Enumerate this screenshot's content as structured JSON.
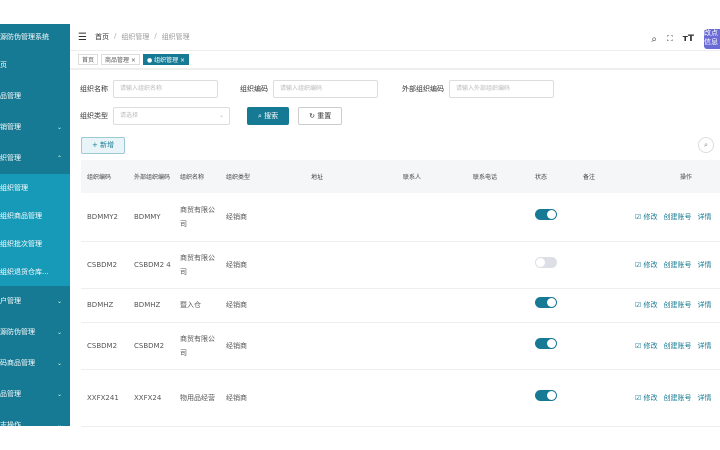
{
  "sidebar": {
    "title": "源防伪管理系统",
    "items": [
      {
        "label": "页"
      },
      {
        "label": "品管理"
      },
      {
        "label": "销管理",
        "chev": "⌄"
      },
      {
        "label": "织管理",
        "chev": "⌃"
      }
    ],
    "sub": [
      {
        "label": "组织管理"
      },
      {
        "label": "组织商品管理"
      },
      {
        "label": "组织批次管理"
      },
      {
        "label": "组织退货仓库..."
      }
    ],
    "items2": [
      {
        "label": "户管理",
        "chev": "⌄"
      },
      {
        "label": "源防伪管理",
        "chev": "⌄"
      },
      {
        "label": "码商品管理",
        "chev": "⌄"
      },
      {
        "label": "品管理",
        "chev": "⌄"
      },
      {
        "label": "志操作",
        "chev": "⌄"
      }
    ]
  },
  "header": {
    "breadcrumb": [
      "首页",
      "组织管理",
      "组织管理"
    ],
    "sep": "/",
    "avatar": "改点信息"
  },
  "tags": [
    {
      "label": "首页"
    },
    {
      "label": "商品管理 ×"
    },
    {
      "label": "● 组织管理 ×"
    }
  ],
  "form": {
    "name_label": "组织名称",
    "name_ph": "请输入组织名称",
    "code_label": "组织编码",
    "code_ph": "请输入组织编码",
    "ext_label": "外部组织编码",
    "ext_ph": "请输入外部组织编码",
    "type_label": "组织类型",
    "type_ph": "请选择",
    "search": "搜索",
    "reset": "重置",
    "add": "+ 新增"
  },
  "table": {
    "headers": [
      "组织编码",
      "外部组织编码",
      "组织名称",
      "组织类型",
      "地址",
      "联系人",
      "联系电话",
      "状态",
      "备注",
      "操作"
    ],
    "rows": [
      {
        "code": "BDMMY2",
        "ext": "BDMMY",
        "name": "商贸有限公司",
        "type": "经销商",
        "on": true
      },
      {
        "code": "CSBDM2",
        "ext": "CSBDM2 4",
        "name": "商贸有限公司",
        "type": "经销商",
        "on": false
      },
      {
        "code": "BDMHZ",
        "ext": "BDMHZ",
        "name": "暨入仓",
        "type": "经销商",
        "on": true
      },
      {
        "code": "CSBDM2",
        "ext": "CSBDM2",
        "name": "商贸有限公司",
        "type": "经销商",
        "on": true
      },
      {
        "code": "XXFX241",
        "ext": "XXFX24",
        "name": "物用品经营",
        "type": "经销商",
        "on": true
      }
    ],
    "ops": [
      "☑ 修改",
      "创建账号",
      "详情"
    ]
  }
}
